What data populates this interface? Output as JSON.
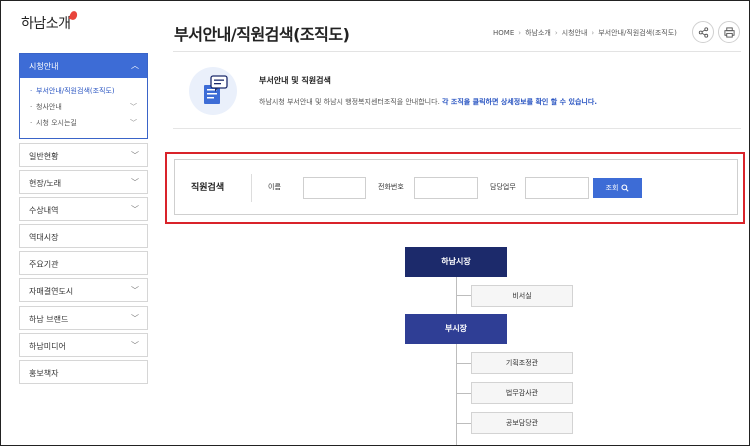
{
  "logo": {
    "text": "하남소개"
  },
  "sidebar": {
    "active": {
      "label": "시청안내",
      "sub_items": [
        {
          "label": "부서안내/직원검색(조직도)",
          "current": true
        },
        {
          "label": "청사안내",
          "current": false
        },
        {
          "label": "시청 오시는길",
          "current": false
        }
      ]
    },
    "items": [
      {
        "label": "일반현황",
        "has_children": true
      },
      {
        "label": "현장/노래",
        "has_children": true
      },
      {
        "label": "수상내역",
        "has_children": true
      },
      {
        "label": "역대시장",
        "has_children": false
      },
      {
        "label": "주요기관",
        "has_children": false
      },
      {
        "label": "자매결연도시",
        "has_children": true
      },
      {
        "label": "하남 브랜드",
        "has_children": true
      },
      {
        "label": "하남미디어",
        "has_children": true
      },
      {
        "label": "홍보책자",
        "has_children": false
      }
    ]
  },
  "header": {
    "title": "부서안내/직원검색(조직도)",
    "breadcrumb": [
      "HOME",
      "하남소개",
      "시청안내",
      "부서안내/직원검색(조직도)"
    ],
    "share_icon": "share-icon",
    "print_icon": "print-icon"
  },
  "intro": {
    "title": "부서안내 및 직원검색",
    "desc": "하남시청 부서안내 및 하남시 행정복지센터조직을 안내합니다. ",
    "desc_highlight": "각 조직을 클릭하면 상세정보를 확인 할 수 있습니다."
  },
  "search": {
    "title": "직원검색",
    "name_label": "이름",
    "name_value": "",
    "phone_label": "전화번호",
    "phone_value": "",
    "duty_label": "담당업무",
    "duty_value": "",
    "button_label": "조회",
    "highlight_color": "#d9232a"
  },
  "org": {
    "mayor": "하남시장",
    "mayor_subs": [
      "비서실"
    ],
    "vice_mayor": "부시장",
    "vice_subs": [
      "기획조정관",
      "법무감사관",
      "공보담당관"
    ]
  },
  "colors": {
    "accent": "#3d6cd6",
    "mayor_box": "#1c2a6b",
    "vice_box": "#2f3e95"
  }
}
